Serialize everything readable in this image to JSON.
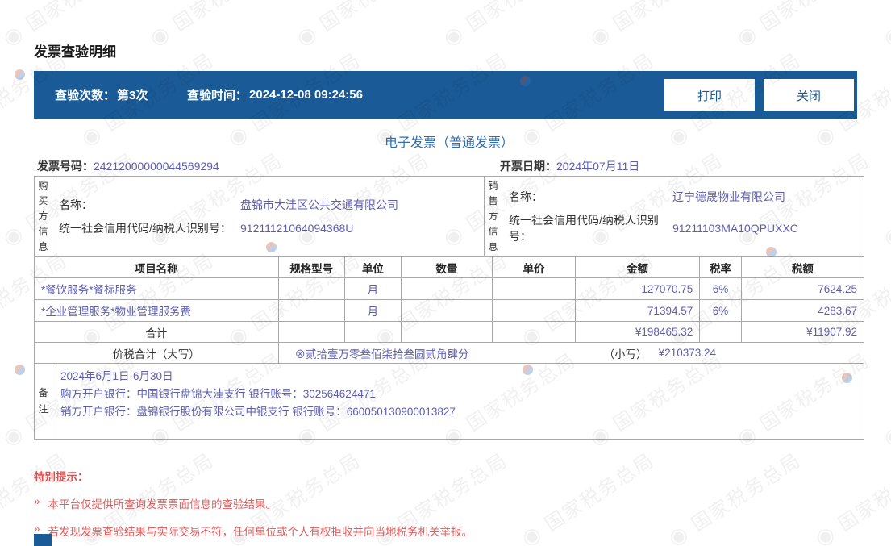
{
  "page": {
    "title": "发票查验明细"
  },
  "verify_bar": {
    "count_label": "查验次数：",
    "count_value": "第3次",
    "time_label": "查验时间：",
    "time_value": "2024-12-08 09:24:56",
    "print_label": "打印",
    "close_label": "关闭"
  },
  "invoice": {
    "type_title": "电子发票（普通发票）",
    "number_label": "发票号码：",
    "number": "24212000000044569294",
    "date_label": "开票日期：",
    "date": "2024年07月11日",
    "buyer": {
      "side_label": "购买方信息",
      "name_label": "名称：",
      "name": "盘锦市大洼区公共交通有限公司",
      "taxid_label": "统一社会信用代码/纳税人识别号：",
      "taxid": "91211121064094368U"
    },
    "seller": {
      "side_label": "销售方信息",
      "name_label": "名称：",
      "name": "辽宁德晟物业有限公司",
      "taxid_label": "统一社会信用代码/纳税人识别号：",
      "taxid": "91211103MA10QPUXXC"
    }
  },
  "items_table": {
    "headers": [
      "项目名称",
      "规格型号",
      "单位",
      "数量",
      "单价",
      "金额",
      "税率",
      "税额"
    ],
    "rows": [
      {
        "name": "*餐饮服务*餐标服务",
        "spec": "",
        "unit": "月",
        "qty": "",
        "price": "",
        "amount": "127070.75",
        "rate": "6%",
        "tax": "7624.25"
      },
      {
        "name": "*企业管理服务*物业管理服务费",
        "spec": "",
        "unit": "月",
        "qty": "",
        "price": "",
        "amount": "71394.57",
        "rate": "6%",
        "tax": "4283.67"
      }
    ],
    "total": {
      "label": "合计",
      "amount": "¥198465.32",
      "tax": "¥11907.92"
    },
    "tax_total": {
      "label": "价税合计（大写）",
      "uppercase": "⊗贰拾壹万零叁佰柒拾叁圆贰角肆分",
      "lowercase_label": "（小写）",
      "lowercase_value": "¥210373.24"
    }
  },
  "remarks": {
    "side_label": "备注",
    "lines": [
      "2024年6月1日-6月30日",
      "购方开户银行：中国银行盘锦大洼支行 银行账号：302564624471",
      "销方开户银行：盘锦银行股份有限公司中银支行 银行账号：660050130900013827"
    ]
  },
  "notice": {
    "title": "特别提示：",
    "bullet": "»",
    "items": [
      "本平台仅提供所查询发票票面信息的查验结果。",
      "若发现发票查验结果与实际交易不符，任何单位或个人有权拒收并向当地税务机关举报。"
    ]
  },
  "watermark": {
    "text": "国家税务总局"
  },
  "colors": {
    "header_bar": "#1a5a96",
    "value_text": "#5e5eb0",
    "title_blue": "#2f6eb4",
    "notice_red": "#e25d5d",
    "border": "#a9a9a9"
  }
}
